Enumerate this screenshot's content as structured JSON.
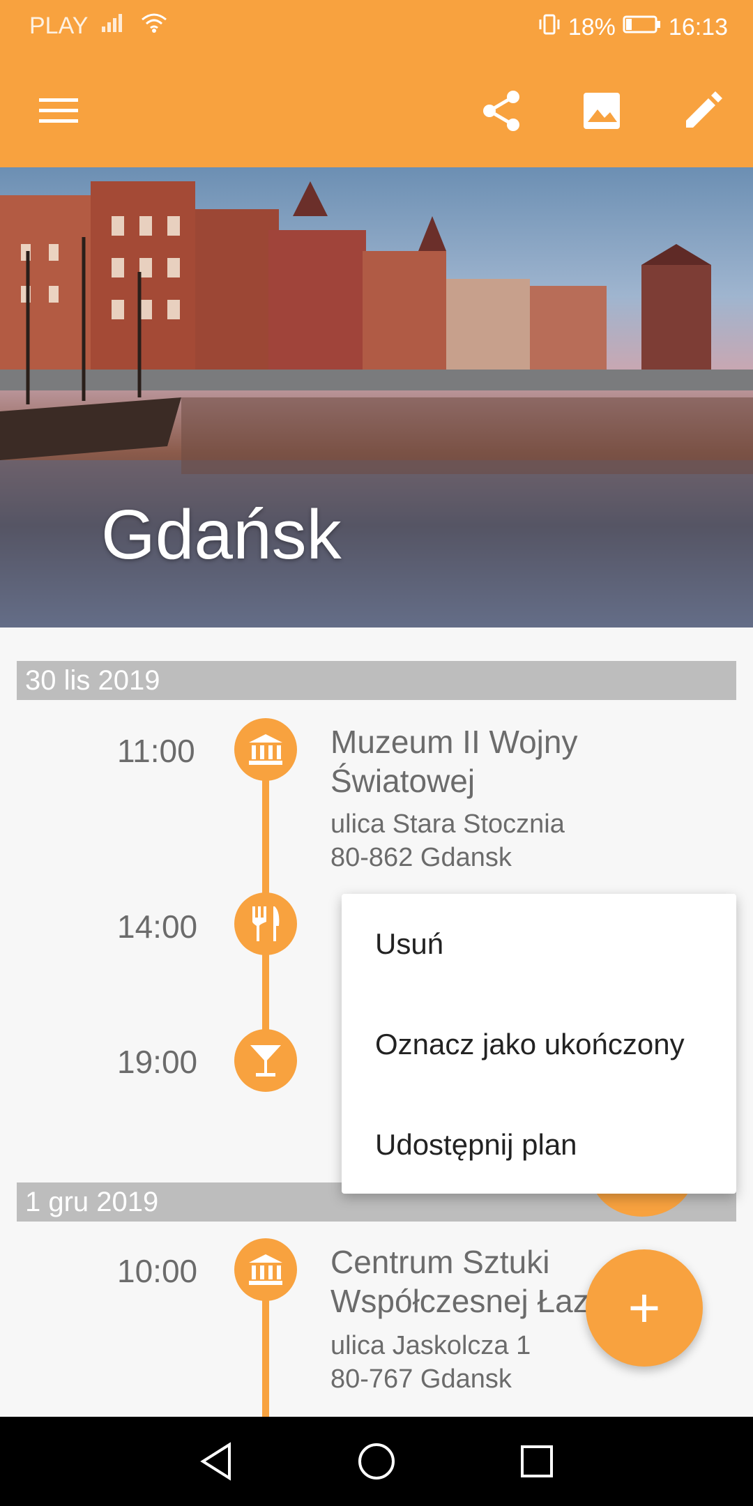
{
  "status": {
    "carrier": "PLAY",
    "battery": "18%",
    "time": "16:13"
  },
  "colors": {
    "accent": "#f8a23f",
    "date_header": "#bdbdbd"
  },
  "appbar": {
    "icons": [
      "menu-icon",
      "share-icon",
      "image-icon",
      "edit-icon"
    ]
  },
  "hero": {
    "title": "Gdańsk"
  },
  "sections": [
    {
      "date": "30 lis 2019",
      "items": [
        {
          "time": "11:00",
          "icon": "museum-icon",
          "title_line1": "Muzeum II Wojny",
          "title_line2": "Światowej",
          "addr_line1": "ulica Stara Stocznia",
          "addr_line2": "80-862 Gdansk"
        },
        {
          "time": "14:00",
          "icon": "restaurant-icon",
          "title_line1": "",
          "title_line2": "",
          "addr_line1": "",
          "addr_line2": ""
        },
        {
          "time": "19:00",
          "icon": "cocktail-icon",
          "title_line1": "",
          "title_line2": "",
          "addr_line1": "",
          "addr_line2": ""
        }
      ]
    },
    {
      "date": "1 gru 2019",
      "items": [
        {
          "time": "10:00",
          "icon": "museum-icon",
          "title_line1": "Centrum Sztuki",
          "title_line2": "Współczesnej Łaz",
          "addr_line1": "ulica Jaskolcza 1",
          "addr_line2": "80-767 Gdansk"
        }
      ]
    }
  ],
  "menu": {
    "items": [
      "Usuń",
      "Oznacz jako ukończony",
      "Udostępnij plan"
    ]
  },
  "fab": {
    "icon": "plus-icon",
    "label": "+"
  },
  "navbar": {
    "icons": [
      "back-icon",
      "home-icon",
      "recents-icon"
    ]
  }
}
